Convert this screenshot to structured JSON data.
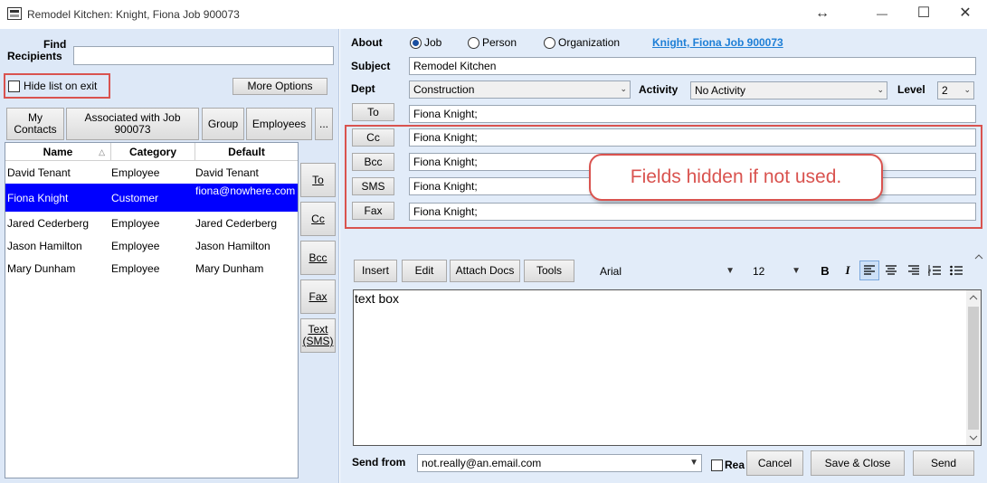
{
  "window": {
    "title": "Remodel Kitchen: Knight, Fiona Job 900073",
    "resize_glyph": "↔",
    "minimize_glyph": "—",
    "maximize_glyph": "☐",
    "close_glyph": "✕"
  },
  "left": {
    "find_label_line1": "Find",
    "find_label_line2": "Recipients",
    "find_value": "",
    "hide_list_label": "Hide list on exit",
    "hide_list_checked": false,
    "more_options": "More Options",
    "tabs": [
      {
        "label": "My Contacts"
      },
      {
        "label": "Associated with Job 900073"
      },
      {
        "label": "Group"
      },
      {
        "label": "Employees"
      },
      {
        "label": "..."
      }
    ],
    "columns": [
      "Name",
      "Category",
      "Default"
    ],
    "sort_glyph": "△",
    "rows": [
      {
        "name": "David Tenant",
        "category": "Employee",
        "default": "David Tenant"
      },
      {
        "name": "Fiona Knight",
        "category": "Customer",
        "default": "fiona@nowhere.com",
        "selected": true
      },
      {
        "name": "Jared Cederberg",
        "category": "Employee",
        "default": "Jared Cederberg"
      },
      {
        "name": "Jason Hamilton",
        "category": "Employee",
        "default": "Jason Hamilton"
      },
      {
        "name": "Mary Dunham",
        "category": "Employee",
        "default": "Mary Dunham"
      }
    ],
    "side_buttons": [
      "To",
      "Cc",
      "Bcc",
      "Fax",
      "Text (SMS)"
    ]
  },
  "right": {
    "about_label": "About",
    "about_options": [
      "Job",
      "Person",
      "Organization"
    ],
    "about_selected": "Job",
    "about_link": "Knight, Fiona Job 900073",
    "subject_label": "Subject",
    "subject_value": "Remodel Kitchen",
    "dept_label": "Dept",
    "dept_value": "Construction",
    "activity_label": "Activity",
    "activity_value": "No Activity",
    "level_label": "Level",
    "level_value": "2",
    "recipients": [
      {
        "button": "To",
        "value": "Fiona Knight;"
      },
      {
        "button": "Cc",
        "value": "Fiona Knight;"
      },
      {
        "button": "Bcc",
        "value": "Fiona Knight;"
      },
      {
        "button": "SMS",
        "value": "Fiona Knight;"
      },
      {
        "button": "Fax",
        "value": "Fiona Knight;"
      }
    ],
    "callout": "Fields hidden if not used.",
    "toolbar": {
      "insert": "Insert",
      "edit": "Edit",
      "attach_docs": "Attach Docs",
      "tools": "Tools",
      "font": "Arial",
      "size": "12",
      "bold": "B",
      "italic": "I"
    },
    "body_text": "text box",
    "send_from_label": "Send from",
    "send_from_value": "not.really@an.email.com",
    "read_label": "Rea",
    "cancel": "Cancel",
    "save_close": "Save & Close",
    "send": "Send"
  },
  "colors": {
    "selection": "#0000ff",
    "annotation_red": "#d9534f",
    "link_blue": "#1e7fd6"
  }
}
